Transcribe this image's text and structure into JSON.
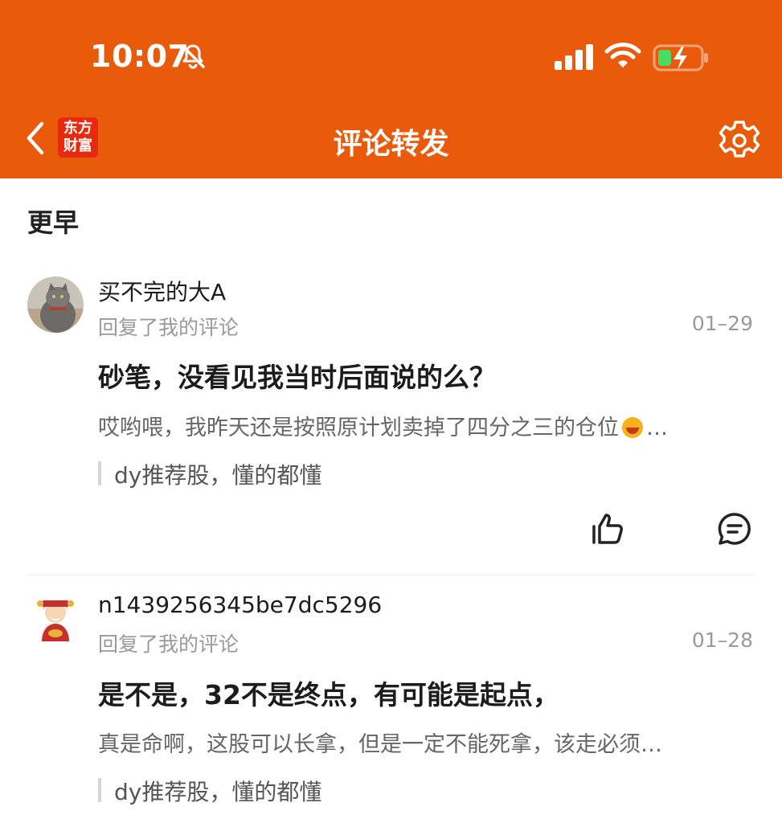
{
  "status_bar": {
    "time": "10:07"
  },
  "nav": {
    "logo_line1": "东方",
    "logo_line2": "财富",
    "title": "评论转发"
  },
  "section": {
    "title": "更早"
  },
  "comments": [
    {
      "username": "买不完的大A",
      "subtitle": "回复了我的评论",
      "date": "01–29",
      "reply": "砂笔，没看见我当时后面说的么？",
      "quote_text": "哎哟喂，我昨天还是按照原计划卖掉了四分之三的仓位",
      "quote_ellipsis": "…",
      "post_title": "dy推荐股，懂的都懂"
    },
    {
      "username": "n1439256345be7dc5296",
      "subtitle": "回复了我的评论",
      "date": "01–28",
      "reply": "是不是，32不是终点，有可能是起点，",
      "quote_text": "真是命啊，这股可以长拿，但是一定不能死拿，该走必须…",
      "post_title": "dy推荐股，懂的都懂"
    }
  ],
  "colors": {
    "brand": "#ea5a0b",
    "logo_red": "#e9290e"
  }
}
